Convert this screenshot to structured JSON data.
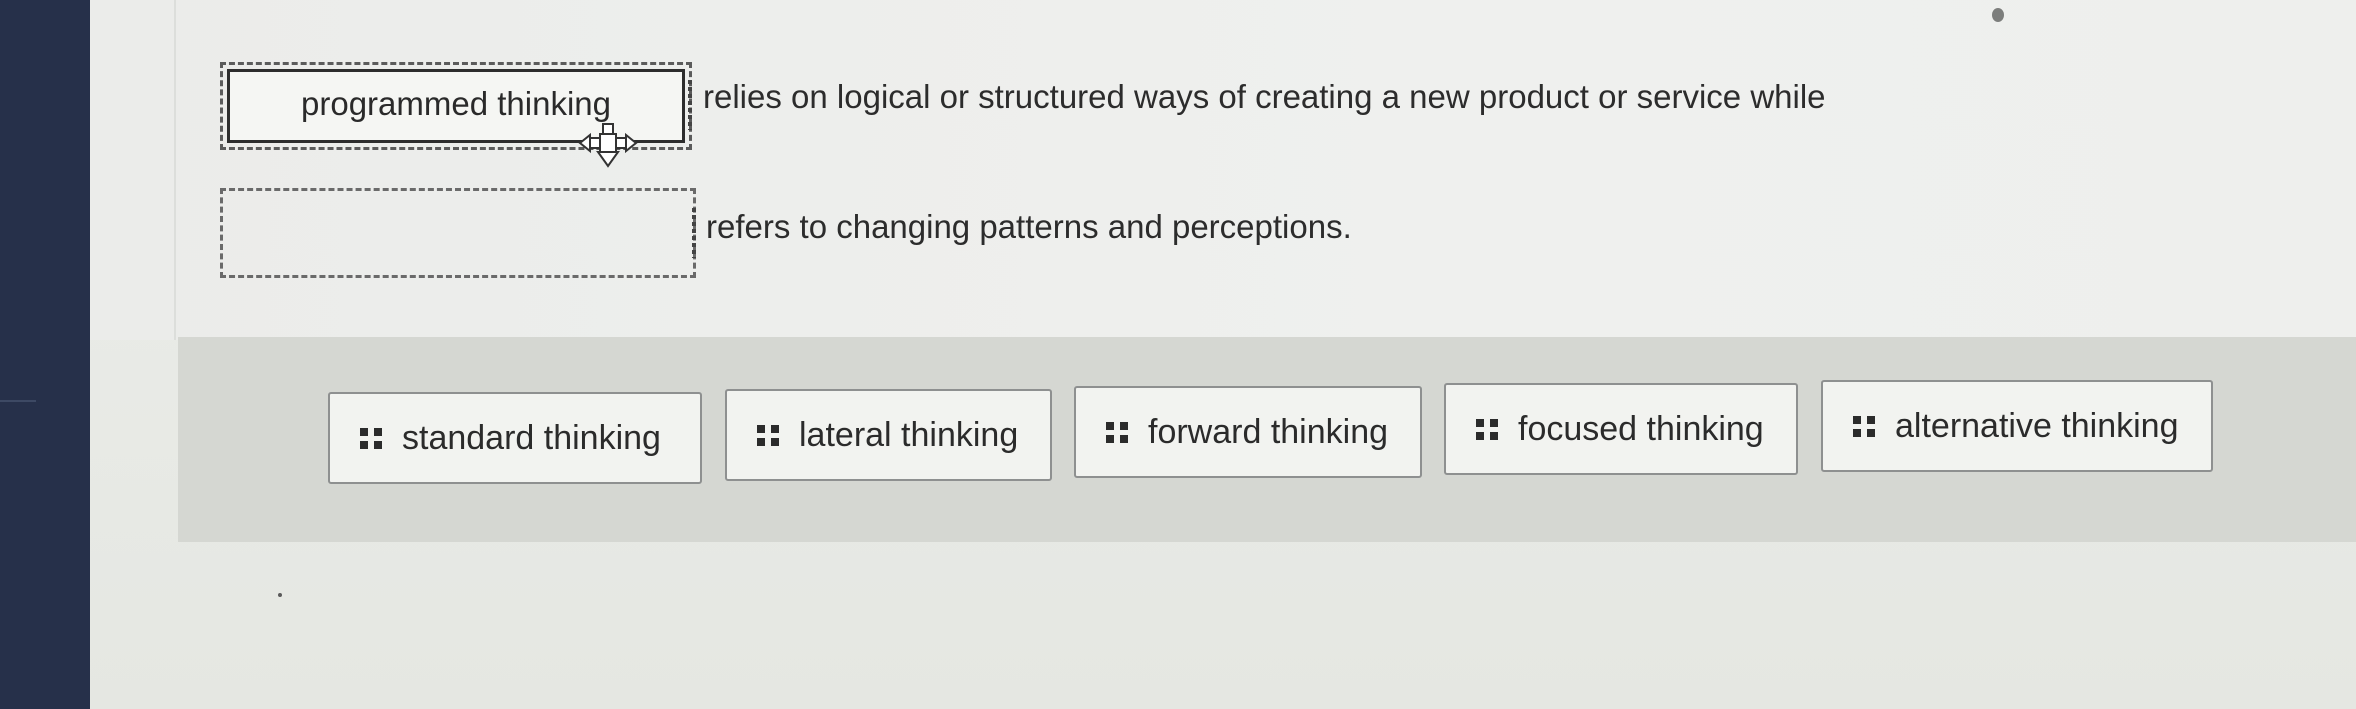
{
  "statements": [
    {
      "answer": "programmed thinking",
      "text": "relies on logical or structured ways of creating a new product or service while"
    },
    {
      "answer": "",
      "text": "refers to changing patterns and perceptions."
    }
  ],
  "options": [
    {
      "label": "standard thinking",
      "icon": "drag-grip-icon"
    },
    {
      "label": "lateral thinking",
      "icon": "drag-grip-icon"
    },
    {
      "label": "forward thinking",
      "icon": "drag-grip-icon"
    },
    {
      "label": "focused thinking",
      "icon": "drag-grip-icon"
    },
    {
      "label": "alternative thinking",
      "icon": "drag-grip-icon"
    }
  ],
  "cursor": {
    "icon": "move-cursor-icon"
  },
  "colors": {
    "sidebar": "#26304a",
    "tray": "#d5d7d2",
    "chip_border": "#8e9090"
  }
}
